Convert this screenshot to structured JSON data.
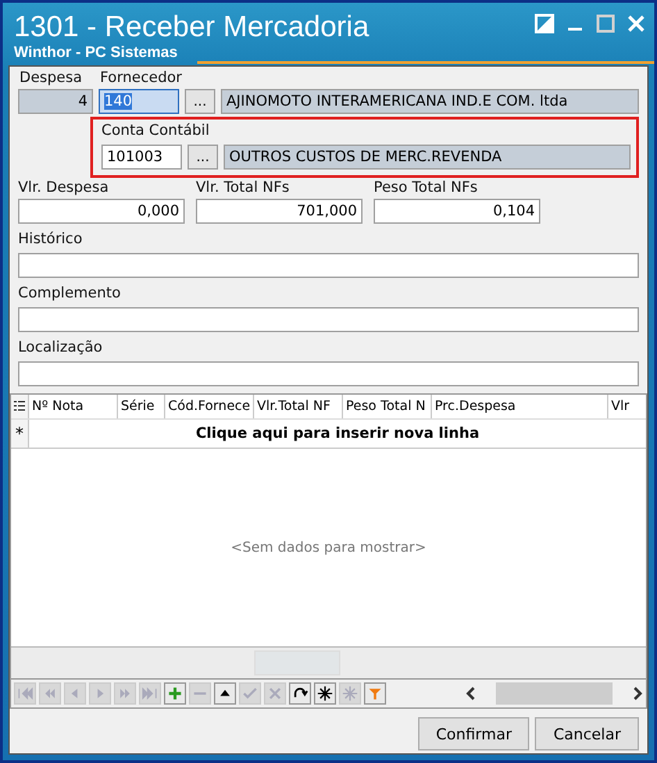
{
  "window": {
    "title": "1301 - Receber Mercadoria",
    "subtitle": "Winthor - PC Sistemas",
    "controls": [
      {
        "kind": "restore"
      },
      {
        "kind": "minimize"
      },
      {
        "kind": "maximize"
      },
      {
        "kind": "close"
      }
    ]
  },
  "despesa": {
    "label": "Despesa",
    "value": "4"
  },
  "fornecedor": {
    "label": "Fornecedor",
    "code": "140",
    "code_selected": true,
    "browse": "...",
    "name": "AJINOMOTO INTERAMERICANA IND.E COM. ltda"
  },
  "conta_contabil": {
    "label": "Conta Contábil",
    "code": "101003",
    "code_selected": false,
    "browse": "...",
    "name": "OUTROS CUSTOS DE MERC.REVENDA",
    "highlighted": true
  },
  "totals": [
    {
      "label": "Vlr. Despesa",
      "value": "0,000"
    },
    {
      "label": "Vlr. Total NFs",
      "value": "701,000"
    },
    {
      "label": "Peso Total NFs",
      "value": "0,104"
    }
  ],
  "text_fields": [
    {
      "label": "Histórico"
    },
    {
      "label": "Complemento"
    },
    {
      "label": "Localização"
    }
  ],
  "grid": {
    "columns": [
      "Nº Nota",
      "Série",
      "Cód.Fornece",
      "Vlr.Total NF",
      "Peso Total N",
      "Prc.Despesa",
      "Vlr"
    ],
    "new_row": "Clique aqui para inserir nova linha",
    "new_row_marker": "*",
    "empty": "<Sem dados para mostrar>"
  },
  "navigator": [
    {
      "kind": "first",
      "disabled": true
    },
    {
      "kind": "prev-page",
      "disabled": true
    },
    {
      "kind": "prev",
      "disabled": true
    },
    {
      "kind": "next",
      "disabled": true
    },
    {
      "kind": "next-page",
      "disabled": true
    },
    {
      "kind": "last",
      "disabled": true
    },
    {
      "kind": "add",
      "disabled": false
    },
    {
      "kind": "delete",
      "disabled": true
    },
    {
      "kind": "up",
      "disabled": false
    },
    {
      "kind": "post",
      "disabled": true
    },
    {
      "kind": "cancel",
      "disabled": true
    },
    {
      "kind": "refresh",
      "disabled": false
    },
    {
      "kind": "star",
      "disabled": false
    },
    {
      "kind": "star",
      "disabled": true
    },
    {
      "kind": "filter",
      "disabled": false
    }
  ],
  "buttons": [
    {
      "label": "Confirmar"
    },
    {
      "label": "Cancelar"
    }
  ]
}
